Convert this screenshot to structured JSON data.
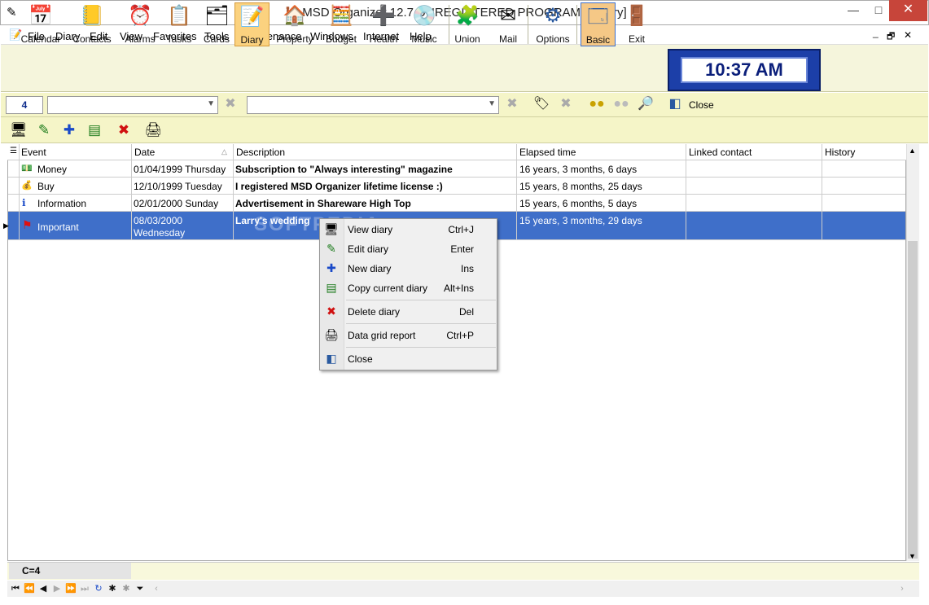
{
  "window": {
    "title": "MSD Organizer 12.7 UNREGISTERED PROGRAM - [Diary]",
    "min": "—",
    "max": "□",
    "close": "✕"
  },
  "menu": [
    "File",
    "Diary",
    "Edit",
    "View",
    "Favorites",
    "Tools",
    "Maintenance",
    "Windows",
    "Internet",
    "Help"
  ],
  "mdi_controls": [
    "_",
    "🗗",
    "✕"
  ],
  "toolbar": [
    {
      "label": "Calendar",
      "icon": "calendar-icon",
      "glyph": "📅"
    },
    {
      "label": "Contacts",
      "icon": "contacts-icon",
      "glyph": "📒"
    },
    {
      "label": "Alarms",
      "icon": "alarm-clock-icon",
      "glyph": "⏰"
    },
    {
      "label": "Tasks",
      "icon": "tasks-icon",
      "glyph": "📋"
    },
    {
      "label": "Cards",
      "icon": "cards-icon",
      "glyph": "🗂"
    },
    {
      "label": "Diary",
      "icon": "diary-icon",
      "glyph": "📝"
    },
    {
      "label": "Property",
      "icon": "house-icon",
      "glyph": "🏠"
    },
    {
      "label": "Budget",
      "icon": "calculator-icon",
      "glyph": "🧮"
    },
    {
      "label": "Health",
      "icon": "health-cross-icon",
      "glyph": "➕"
    },
    {
      "label": "Music",
      "icon": "music-cd-icon",
      "glyph": "💿"
    },
    {
      "label": "Union",
      "icon": "puzzle-icon",
      "glyph": "🧩"
    },
    {
      "label": "Mail",
      "icon": "envelope-icon",
      "glyph": "✉"
    },
    {
      "label": "Options",
      "icon": "gears-icon",
      "glyph": "⚙"
    },
    {
      "label": "Basic",
      "icon": "window-layout-icon",
      "glyph": "🗔"
    },
    {
      "label": "Exit",
      "icon": "exit-door-icon",
      "glyph": "🚪"
    }
  ],
  "clock": "10:37 AM",
  "filter": {
    "count": "4",
    "close_label": "Close"
  },
  "grid": {
    "headers": [
      "Event",
      "Date",
      "Description",
      "Elapsed time",
      "Linked contact",
      "History"
    ],
    "rows": [
      {
        "event": "Money",
        "icon": "money-icon",
        "glyph": "💵",
        "date": "01/04/1999 Thursday",
        "desc": "Subscription to \"Always interesting\" magazine",
        "elapsed": "16 years, 3 months, 6 days"
      },
      {
        "event": "Buy",
        "icon": "money-bag-icon",
        "glyph": "💰",
        "date": "12/10/1999 Tuesday",
        "desc": "I registered MSD Organizer lifetime license :)",
        "elapsed": "15 years, 8 months, 25 days"
      },
      {
        "event": "Information",
        "icon": "info-icon",
        "glyph": "ℹ",
        "date": "02/01/2000 Sunday",
        "desc": "Advertisement in Shareware High Top",
        "elapsed": "15 years, 6 months, 5 days"
      },
      {
        "event": "Important",
        "icon": "red-flag-icon",
        "glyph": "⚑",
        "date": "08/03/2000",
        "date2": "Wednesday",
        "desc": "Larry's wedding",
        "elapsed": "15 years, 3 months, 29 days"
      }
    ]
  },
  "status": "C=4",
  "context_menu": [
    {
      "label": "View diary",
      "shortcut": "Ctrl+J",
      "icon": "monitor-icon",
      "glyph": "🖥"
    },
    {
      "label": "Edit diary",
      "shortcut": "Enter",
      "icon": "edit-icon",
      "glyph": "✎"
    },
    {
      "label": "New diary",
      "shortcut": "Ins",
      "icon": "new-icon",
      "glyph": "✚"
    },
    {
      "label": "Copy current diary",
      "shortcut": "Alt+Ins",
      "icon": "copy-icon",
      "glyph": "▤"
    },
    {
      "label": "Delete diary",
      "shortcut": "Del",
      "icon": "delete-icon",
      "glyph": "✖"
    },
    {
      "label": "Data grid report",
      "shortcut": "Ctrl+P",
      "icon": "printer-icon",
      "glyph": "🖨"
    },
    {
      "label": "Close",
      "shortcut": "",
      "icon": "close-window-icon",
      "glyph": "◧"
    }
  ],
  "colors": {
    "toolbar_bg": "#f5f5dc",
    "selection": "#3f6fc9",
    "clock_bg": "#1c3fa8"
  }
}
